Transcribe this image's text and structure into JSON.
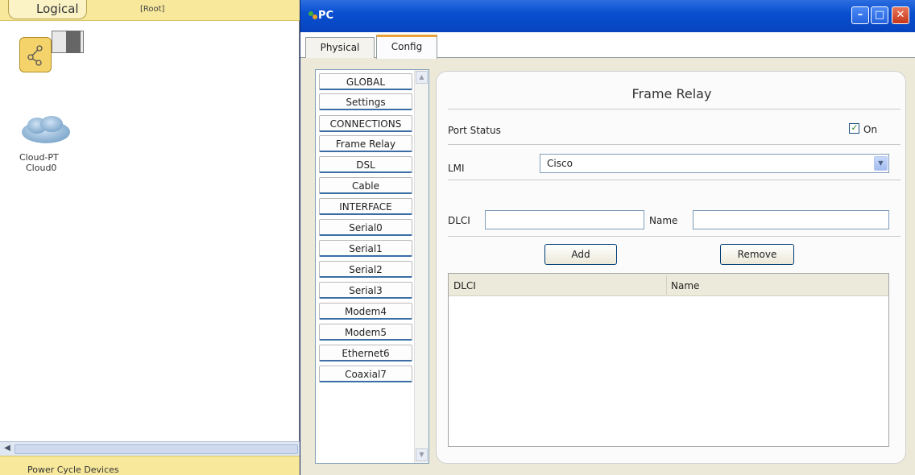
{
  "workspace": {
    "mode_title": "Logical",
    "location": "[Root]",
    "device": {
      "type": "Cloud-PT",
      "name": "Cloud0"
    },
    "status_text": "Power Cycle Devices"
  },
  "window": {
    "title": "PC",
    "tabs": [
      "Physical",
      "Config"
    ],
    "active_tab": "Config"
  },
  "nav": {
    "items": [
      "GLOBAL",
      "Settings",
      "CONNECTIONS",
      "Frame Relay",
      "DSL",
      "Cable",
      "INTERFACE",
      "Serial0",
      "Serial1",
      "Serial2",
      "Serial3",
      "Modem4",
      "Modem5",
      "Ethernet6",
      "Coaxial7"
    ]
  },
  "panel": {
    "title": "Frame Relay",
    "port_status_label": "Port Status",
    "on_label": "On",
    "on_checked": true,
    "lmi_label": "LMI",
    "lmi_value": "Cisco",
    "dlci_label": "DLCI",
    "name_label": "Name",
    "add_label": "Add",
    "remove_label": "Remove",
    "table_columns": [
      "DLCI",
      "Name"
    ]
  },
  "colors": {
    "titlebar": "#0a4fd0",
    "workspace_bar": "#f7e89c",
    "tab_accent": "#e8a33a"
  }
}
